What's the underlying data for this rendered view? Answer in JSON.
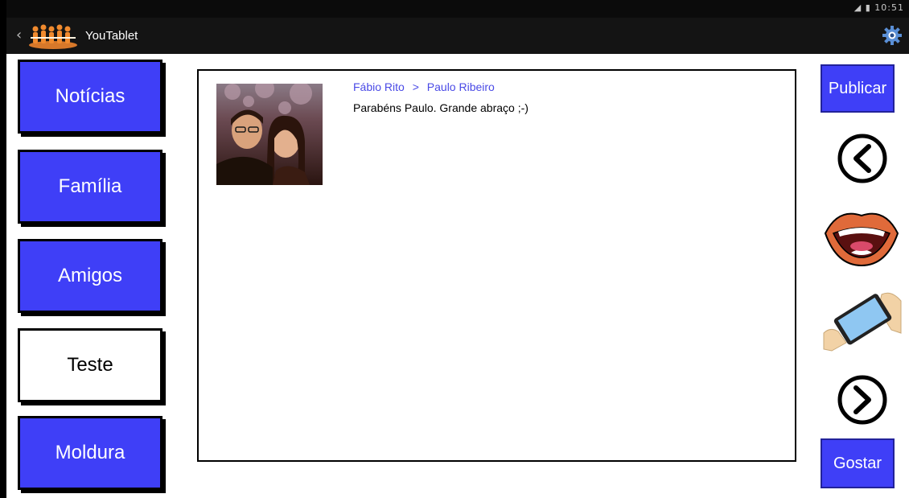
{
  "app": {
    "title": "YouTablet",
    "status_time": "10:51",
    "icons": {
      "back": "chevron-left-icon",
      "logo": "people-group-logo",
      "settings": "gear-icon"
    }
  },
  "nav": {
    "items": [
      {
        "label": "Notícias",
        "selected": false
      },
      {
        "label": "Família",
        "selected": false
      },
      {
        "label": "Amigos",
        "selected": false
      },
      {
        "label": "Teste",
        "selected": true
      },
      {
        "label": "Moldura",
        "selected": false
      }
    ]
  },
  "post": {
    "author": "Fábio Rito",
    "separator": ">",
    "recipient": "Paulo Ribeiro",
    "message": "Parabéns Paulo.  Grande abraço ;-)"
  },
  "actions": {
    "publish_label": "Publicar",
    "like_label": "Gostar",
    "icons": {
      "previous": "circle-chevron-left-icon",
      "speak": "mouth-speak-icon",
      "tablet": "tablet-hands-icon",
      "next": "circle-chevron-right-icon"
    }
  },
  "colors": {
    "accent": "#3f3ff7",
    "link": "#4a4ae6",
    "bar": "#141414"
  }
}
